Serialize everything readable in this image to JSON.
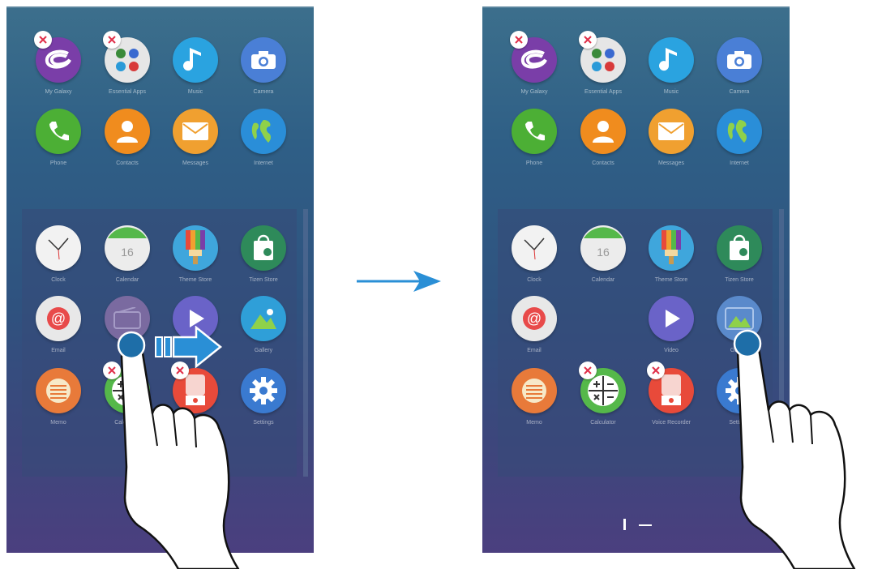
{
  "panels": [
    {
      "apps": [
        {
          "label": "My Galaxy",
          "icon": "galaxy-icon",
          "color": "#7a3ea8",
          "removable": true
        },
        {
          "label": "Essential Apps",
          "icon": "folder-icon",
          "color": "#e6e6e6",
          "removable": true
        },
        {
          "label": "Music",
          "icon": "music-note-icon",
          "color": "#2aa3e0",
          "removable": false
        },
        {
          "label": "Camera",
          "icon": "camera-icon",
          "color": "#4a7fd6",
          "removable": false
        },
        {
          "label": "Phone",
          "icon": "phone-icon",
          "color": "#4caf35",
          "removable": false
        },
        {
          "label": "Contacts",
          "icon": "contacts-icon",
          "color": "#f08c1e",
          "removable": false
        },
        {
          "label": "Messages",
          "icon": "envelope-icon",
          "color": "#f0a030",
          "removable": false
        },
        {
          "label": "Internet",
          "icon": "globe-icon",
          "color": "#2a8ed8",
          "removable": false
        },
        {
          "label": "Clock",
          "icon": "clock-icon",
          "color": "#f2f2f2",
          "removable": false
        },
        {
          "label": "Calendar",
          "icon": "calendar-icon",
          "color": "#ececec",
          "removable": false
        },
        {
          "label": "Theme Store",
          "icon": "brush-icon",
          "color": "#3fa6dc",
          "removable": false
        },
        {
          "label": "Tizen Store",
          "icon": "store-bag-icon",
          "color": "#2e8a5a",
          "removable": false
        },
        {
          "label": "Email",
          "icon": "at-icon",
          "color": "#e8e8e8",
          "removable": false
        },
        {
          "label": "Radio",
          "icon": "radio-icon",
          "color": "#7a6aa0",
          "removable": false
        },
        {
          "label": "Video",
          "icon": "play-icon",
          "color": "#6a63c8",
          "removable": false
        },
        {
          "label": "Gallery",
          "icon": "gallery-icon",
          "color": "#2f9fd8",
          "removable": false
        },
        {
          "label": "Memo",
          "icon": "memo-icon",
          "color": "#e87a3a",
          "removable": false
        },
        {
          "label": "Calculator",
          "icon": "calculator-icon",
          "color": "#55b84a",
          "removable": true
        },
        {
          "label": "Voice Recorder",
          "icon": "voice-recorder-icon",
          "color": "#e84a3a",
          "removable": true
        },
        {
          "label": "Settings",
          "icon": "gear-icon",
          "color": "#3a7ad0",
          "removable": false
        }
      ]
    },
    {
      "apps": [
        {
          "label": "My Galaxy",
          "icon": "galaxy-icon",
          "color": "#7a3ea8",
          "removable": true
        },
        {
          "label": "Essential Apps",
          "icon": "folder-icon",
          "color": "#e6e6e6",
          "removable": true
        },
        {
          "label": "Music",
          "icon": "music-note-icon",
          "color": "#2aa3e0",
          "removable": false
        },
        {
          "label": "Camera",
          "icon": "camera-icon",
          "color": "#4a7fd6",
          "removable": false
        },
        {
          "label": "Phone",
          "icon": "phone-icon",
          "color": "#4caf35",
          "removable": false
        },
        {
          "label": "Contacts",
          "icon": "contacts-icon",
          "color": "#f08c1e",
          "removable": false
        },
        {
          "label": "Messages",
          "icon": "envelope-icon",
          "color": "#f0a030",
          "removable": false
        },
        {
          "label": "Internet",
          "icon": "globe-icon",
          "color": "#2a8ed8",
          "removable": false
        },
        {
          "label": "Clock",
          "icon": "clock-icon",
          "color": "#f2f2f2",
          "removable": false
        },
        {
          "label": "Calendar",
          "icon": "calendar-icon",
          "color": "#ececec",
          "removable": false
        },
        {
          "label": "Theme Store",
          "icon": "brush-icon",
          "color": "#3fa6dc",
          "removable": false
        },
        {
          "label": "Tizen Store",
          "icon": "store-bag-icon",
          "color": "#2e8a5a",
          "removable": false
        },
        {
          "label": "Email",
          "icon": "at-icon",
          "color": "#e8e8e8",
          "removable": false
        },
        {
          "label": "",
          "icon": "",
          "color": "",
          "removable": false
        },
        {
          "label": "Video",
          "icon": "play-icon",
          "color": "#6a63c8",
          "removable": false
        },
        {
          "label": "Gallery",
          "icon": "radio-gallery-icon",
          "color": "#5a8acb",
          "removable": false
        },
        {
          "label": "Memo",
          "icon": "memo-icon",
          "color": "#e87a3a",
          "removable": false
        },
        {
          "label": "Calculator",
          "icon": "calculator-icon",
          "color": "#55b84a",
          "removable": true
        },
        {
          "label": "Voice Recorder",
          "icon": "voice-recorder-icon",
          "color": "#e84a3a",
          "removable": true
        },
        {
          "label": "Settings",
          "icon": "gear-icon",
          "color": "#3a7ad0",
          "removable": false
        }
      ]
    }
  ],
  "transition_arrow_color": "#2a8fd6",
  "drag_arrow_color": "#2a8fd6"
}
